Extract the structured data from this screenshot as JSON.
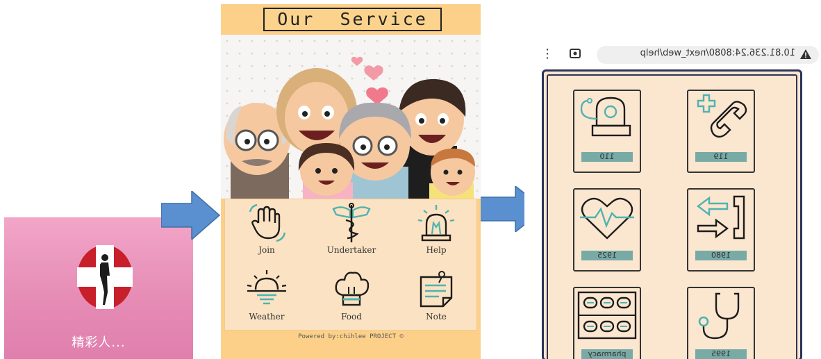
{
  "app": {
    "label": "精彩人..."
  },
  "service_screen": {
    "title": "Our  Service",
    "items": [
      {
        "label": "Join",
        "icon": "raised-hand-icon"
      },
      {
        "label": "Undertaker",
        "icon": "caduceus-icon"
      },
      {
        "label": "Help",
        "icon": "siren-icon"
      },
      {
        "label": "Weather",
        "icon": "sunrise-icon"
      },
      {
        "label": "Food",
        "icon": "chef-hat-icon"
      },
      {
        "label": "Note",
        "icon": "note-icon"
      }
    ],
    "footer": "Powered by:chihlee PROJECT ©"
  },
  "help_screen": {
    "url": "10.81.236.24:8080/next_web/help",
    "cards": [
      {
        "number": "110",
        "icon": "police-siren-icon"
      },
      {
        "number": "119",
        "icon": "emergency-phone-icon"
      },
      {
        "number": "1925",
        "icon": "heartbeat-icon"
      },
      {
        "number": "1980",
        "icon": "call-transfer-icon"
      },
      {
        "number": "pharmacy",
        "icon": "pills-icon"
      },
      {
        "number": "1995",
        "icon": "stethoscope-icon"
      }
    ]
  },
  "colors": {
    "accent_teal": "#4fb3b0",
    "service_bg": "#fcd089",
    "card_label": "#78aaa6",
    "app_tile": "#e58bb4",
    "arrow": "#5a8fd0"
  }
}
